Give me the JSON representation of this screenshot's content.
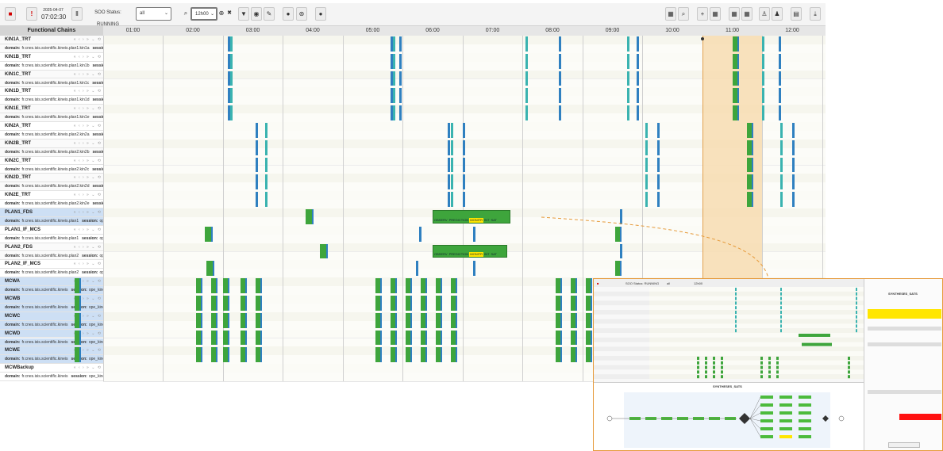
{
  "toolbar": {
    "date": "2025-04-07",
    "time": "07:02:30",
    "status_label": "SOO Status: RUNNING",
    "filter_value": "all",
    "zoom_value": "12h00",
    "zoom_close_glyph": "✖",
    "icons": [
      "stop-icon",
      "alert-icon",
      "pause-icon",
      "zoom-icon",
      "zoom-in-icon",
      "filter-icon",
      "visibility-icon",
      "edit-icon",
      "record-icon",
      "target-icon",
      "drop-icon"
    ]
  },
  "grid": {
    "left_header": "Functional Chains",
    "hours": [
      "01:00",
      "02:00",
      "03:00",
      "04:00",
      "05:00",
      "06:00",
      "07:00",
      "08:00",
      "09:00",
      "10:00",
      "11:00",
      "12:00"
    ],
    "row_controls": "« ‹ › » ⌄ ⟲",
    "domain_label": "domain:",
    "session_label": "session:"
  },
  "chains": [
    {
      "name": "KIN1A_TRT",
      "domain": "fr.cnes.isis.scientific.kineis.plan1.kin1a",
      "session": "o",
      "highlight": false
    },
    {
      "name": "KIN1B_TRT",
      "domain": "fr.cnes.isis.scientific.kineis.plan1.kin1b",
      "session": "o",
      "highlight": false
    },
    {
      "name": "KIN1C_TRT",
      "domain": "fr.cnes.isis.scientific.kineis.plan1.kin1c",
      "session": "o",
      "highlight": false
    },
    {
      "name": "KIN1D_TRT",
      "domain": "fr.cnes.isis.scientific.kineis.plan1.kin1d",
      "session": "o",
      "highlight": false
    },
    {
      "name": "KIN1E_TRT",
      "domain": "fr.cnes.isis.scientific.kineis.plan1.kin1e",
      "session": "o",
      "highlight": false
    },
    {
      "name": "KIN2A_TRT",
      "domain": "fr.cnes.isis.scientific.kineis.plan2.kin2a",
      "session": "o",
      "highlight": false
    },
    {
      "name": "KIN2B_TRT",
      "domain": "fr.cnes.isis.scientific.kineis.plan2.kin2b",
      "session": "o",
      "highlight": false
    },
    {
      "name": "KIN2C_TRT",
      "domain": "fr.cnes.isis.scientific.kineis.plan2.kin2c",
      "session": "o",
      "highlight": false
    },
    {
      "name": "KIN2D_TRT",
      "domain": "fr.cnes.isis.scientific.kineis.plan2.kin2d",
      "session": "o",
      "highlight": false
    },
    {
      "name": "KIN2E_TRT",
      "domain": "fr.cnes.isis.scientific.kineis.plan2.kin2e",
      "session": "o",
      "highlight": false
    },
    {
      "name": "PLAN1_FDS",
      "domain": "fr.cnes.isis.scientific.kineis.plan1",
      "session": "ope_kin",
      "highlight": true
    },
    {
      "name": "PLAN1_IF_MCS",
      "domain": "fr.cnes.isis.scientific.kineis.plan1",
      "session": "ope_kin",
      "highlight": false
    },
    {
      "name": "PLAN2_FDS",
      "domain": "fr.cnes.isis.scientific.kineis.plan2",
      "session": "ope_kin",
      "highlight": false
    },
    {
      "name": "PLAN2_IF_MCS",
      "domain": "fr.cnes.isis.scientific.kineis.plan2",
      "session": "ope_kin",
      "highlight": false
    },
    {
      "name": "MCWA",
      "domain": "fr.cnes.isis.scientific.kineis",
      "session": "ope_kineis",
      "highlight": true
    },
    {
      "name": "MCWB",
      "domain": "fr.cnes.isis.scientific.kineis",
      "session": "ope_kineis",
      "highlight": true
    },
    {
      "name": "MCWC",
      "domain": "fr.cnes.isis.scientific.kineis",
      "session": "ope_kineis",
      "highlight": true
    },
    {
      "name": "MCWD",
      "domain": "fr.cnes.isis.scientific.kineis",
      "session": "ope_kineis",
      "highlight": true
    },
    {
      "name": "MCWE",
      "domain": "fr.cnes.isis.scientific.kineis",
      "session": "ope_kineis",
      "highlight": true
    },
    {
      "name": "MCWBackup",
      "domain": "fr.cnes.isis.scientific.kineis",
      "session": "ope_kineis",
      "highlight": false
    }
  ],
  "now_window_hours": [
    10.5,
    11.5
  ],
  "events": {
    "kin1": [
      2.58,
      2.62,
      5.3,
      5.34,
      5.45,
      7.55,
      8.1,
      9.25,
      9.4,
      11.5,
      11.78
    ],
    "kin2": [
      3.05,
      3.2,
      6.25,
      6.3,
      6.5,
      9.55,
      9.75,
      11.8,
      12.0
    ],
    "mcw": [
      0.02,
      2.05,
      2.3,
      2.5,
      2.8,
      3.05,
      5.05,
      5.3,
      5.55,
      5.8,
      6.05,
      6.3,
      8.05,
      8.3,
      8.55,
      8.8,
      9.05
    ]
  },
  "process_blocks": {
    "plan1_fds": {
      "start": 6.0,
      "end": 7.3,
      "labels": [
        "OBSERV",
        "PREDICTION",
        "MONITR",
        "INT",
        "SAT"
      ]
    },
    "plan2_fds": {
      "start": 6.0,
      "end": 7.25,
      "labels": [
        "OBSERV",
        "PREDICTION",
        "MONITR",
        "INT",
        "SAT"
      ]
    },
    "single_blocks": [
      {
        "row": 10,
        "hour": 3.88
      },
      {
        "row": 12,
        "hour": 4.12
      },
      {
        "row": 11,
        "hour": 2.2
      },
      {
        "row": 13,
        "hour": 2.22
      }
    ]
  },
  "inset": {
    "status": "SOO Status: RUNNING",
    "filter": "all",
    "zoom": "12h00",
    "panel_title": "SYNTHESES_SATS",
    "graph_title": "SYNTHESES_SATS"
  },
  "colors": {
    "accent": "#2e6fb7",
    "event_blue": "#2f80c0",
    "event_teal": "#3ab3b0",
    "block_green": "#3ea53c",
    "block_yellow": "#ffe600",
    "now_window": "#f8ddb2",
    "highlight_row": "#cddff4",
    "connector": "#e69a3a"
  }
}
